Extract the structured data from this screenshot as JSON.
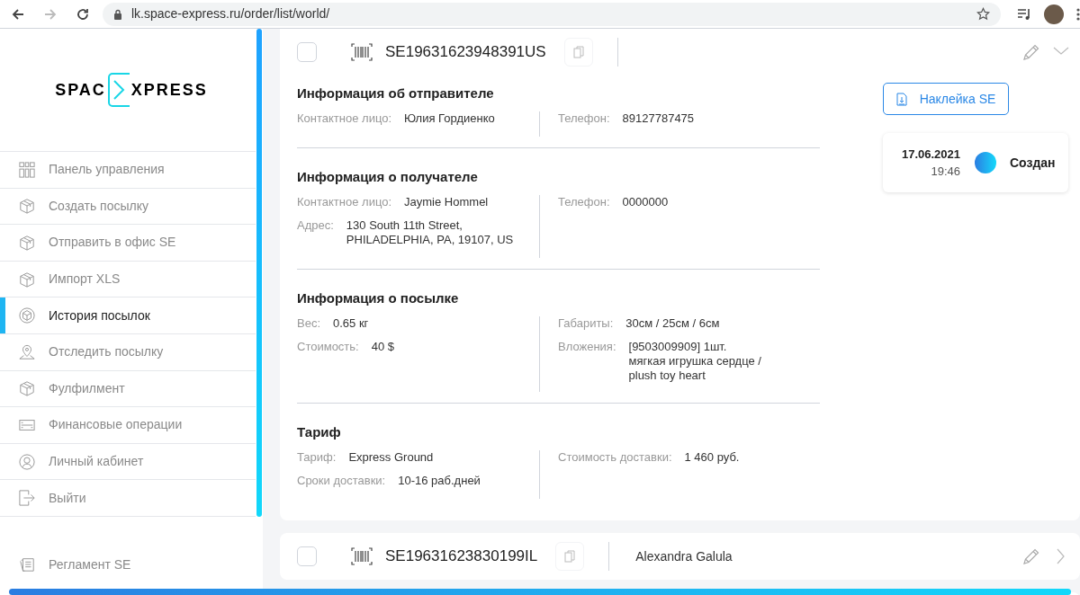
{
  "browser": {
    "url": "lk.space-express.ru/order/list/world/",
    "forward_disabled": true
  },
  "logo": {
    "left": "SPAC",
    "right": "XPRESS"
  },
  "sidebar": {
    "items": [
      {
        "label": "Панель управления",
        "selected": false
      },
      {
        "label": "Создать посылку",
        "selected": false
      },
      {
        "label": "Отправить в офис SE",
        "selected": false
      },
      {
        "label": "Импорт XLS",
        "selected": false
      },
      {
        "label": "История посылок",
        "selected": true
      },
      {
        "label": "Отследить посылку",
        "selected": false
      },
      {
        "label": "Фулфилмент",
        "selected": false
      },
      {
        "label": "Финансовые операции",
        "selected": false
      },
      {
        "label": "Личный кабинет",
        "selected": false
      },
      {
        "label": "Выйти",
        "selected": false
      }
    ],
    "footer_item": {
      "label": "Регламент SE"
    }
  },
  "orders": [
    {
      "id": "SE19631623948391US",
      "checked": false,
      "expanded": true,
      "sections": [
        {
          "title": "Информация об отправителе",
          "left": [
            {
              "label": "Контактное лицо:",
              "value": "Юлия Гордиенко"
            }
          ],
          "right": [
            {
              "label": "Телефон:",
              "value": "89127787475"
            }
          ]
        },
        {
          "title": "Информация о получателе",
          "left": [
            {
              "label": "Контактное лицо:",
              "value": "Jaymie Hommel"
            },
            {
              "label": "Адрес:",
              "value": "130 South 11th Street,\nPHILADELPHIA, PA, 19107, US"
            }
          ],
          "right": [
            {
              "label": "Телефон:",
              "value": "0000000"
            }
          ]
        },
        {
          "title": "Информация о посылке",
          "left": [
            {
              "label": "Вес:",
              "value": "0.65 кг"
            },
            {
              "label": "Стоимость:",
              "value": "40 $"
            }
          ],
          "right": [
            {
              "label": "Габариты:",
              "value": "30см / 25см / 6см"
            },
            {
              "label": "Вложения:",
              "value": "[9503009909] 1шт.\nмягкая игрушка сердце /\nplush toy heart"
            }
          ]
        },
        {
          "title": "Тариф",
          "left": [
            {
              "label": "Тариф:",
              "value": "Express Ground"
            },
            {
              "label": "Сроки доставки:",
              "value": "10-16 раб.дней"
            }
          ],
          "right": [
            {
              "label": "Стоимость доставки:",
              "value": "1 460 руб."
            }
          ]
        }
      ],
      "sticker_button": "Наклейка SE",
      "status": {
        "date": "17.06.2021",
        "time": "19:46",
        "label": "Создан"
      }
    },
    {
      "id": "SE19631623830199IL",
      "checked": false,
      "expanded": false,
      "recipient": "Alexandra Galula"
    }
  ]
}
